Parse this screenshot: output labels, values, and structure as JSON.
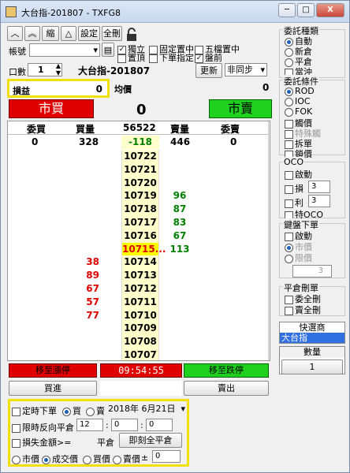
{
  "window": {
    "title": "大台指-201807 - TXFG8",
    "min": "─",
    "max": "□",
    "close": "X"
  },
  "toolbar": {
    "up1": "︿",
    "up2": "︽",
    "shrink": "縮",
    "triangle": "△",
    "settings": "設定",
    "delete_all": "全刪"
  },
  "account": {
    "label": "帳號",
    "value": ""
  },
  "opts": {
    "independent": {
      "label": "獨立",
      "checked": true
    },
    "pin": {
      "label": "置頂",
      "checked": false
    },
    "fixed_center": {
      "label": "固定置中",
      "checked": false
    },
    "below_specify": {
      "label": "下單指定",
      "checked": false
    },
    "five_center": {
      "label": "五檔置中",
      "checked": false
    },
    "ticks": {
      "label": "盤前",
      "checked": true
    }
  },
  "qty": {
    "label": "口數",
    "value": "1"
  },
  "product": {
    "name": "大台指-201807",
    "refresh": "更新",
    "sync": "非同步"
  },
  "pnl": {
    "label": "損益",
    "value": "0",
    "avg_label": "均價",
    "avg_value": "0"
  },
  "market_buy": "市買",
  "market_sell": "市賣",
  "center_position": "0",
  "grid": {
    "headers": {
      "bid_order": "委買",
      "bid_qty": "買量",
      "price": "56522",
      "ask_qty": "賣量",
      "ask_order": "委賣"
    },
    "summary": {
      "bid_order": "0",
      "bid_qty": "328",
      "change": "-118",
      "ask_qty": "446",
      "ask_order": "0"
    },
    "rows": [
      {
        "price": "10722",
        "bid": "",
        "ask": ""
      },
      {
        "price": "10721",
        "bid": "",
        "ask": ""
      },
      {
        "price": "10720",
        "bid": "",
        "ask": ""
      },
      {
        "price": "10719",
        "bid": "",
        "ask": "96"
      },
      {
        "price": "10718",
        "bid": "",
        "ask": "87"
      },
      {
        "price": "10717",
        "bid": "",
        "ask": "83"
      },
      {
        "price": "10716",
        "bid": "",
        "ask": "67"
      },
      {
        "price": "10715...",
        "bid": "",
        "ask": "113",
        "current": true
      },
      {
        "price": "10714",
        "bid": "38",
        "ask": ""
      },
      {
        "price": "10713",
        "bid": "89",
        "ask": ""
      },
      {
        "price": "10712",
        "bid": "67",
        "ask": ""
      },
      {
        "price": "10711",
        "bid": "57",
        "ask": ""
      },
      {
        "price": "10710",
        "bid": "77",
        "ask": ""
      },
      {
        "price": "10709",
        "bid": "",
        "ask": ""
      },
      {
        "price": "10708",
        "bid": "",
        "ask": ""
      },
      {
        "price": "10707",
        "bid": "",
        "ask": ""
      }
    ]
  },
  "bottom": {
    "move_stop_loss": "移至漲停",
    "time": "09:54:55",
    "move_stop_down": "移至跌停",
    "buy": "買進",
    "sell": "賣出"
  },
  "schedule": {
    "timed_order": "定時下單",
    "buy": "買",
    "sell": "賣",
    "date": "2018年 6月21日",
    "reverse_close": "限時反向平倉",
    "hh": "12",
    "mm": "0",
    "ss": "0",
    "loss_amount": "損失金額>=",
    "close_label": "平倉",
    "close_all": "即刻全平倉",
    "market": "市價",
    "deal_price": "成交價",
    "bid_price": "買價",
    "ask_price": "賣價",
    "plusminus": "±",
    "offset": "0"
  },
  "order_type": {
    "title": "委託種類",
    "items": [
      {
        "label": "自動",
        "selected": true
      },
      {
        "label": "新倉",
        "selected": false
      },
      {
        "label": "平倉",
        "selected": false
      },
      {
        "label": "當沖",
        "selected": false
      }
    ]
  },
  "order_cond": {
    "title": "委託條件",
    "items": [
      {
        "label": "ROD",
        "selected": true
      },
      {
        "label": "IOC",
        "selected": false
      },
      {
        "label": "FOK",
        "selected": false
      }
    ],
    "checks": [
      "觸價",
      "特殊觸",
      "拆單",
      "鎖價"
    ]
  },
  "oco": {
    "title": "OCO",
    "start": "啟動",
    "loss": "損",
    "loss_v": "3",
    "profit": "利",
    "profit_v": "3",
    "special": "特OCO"
  },
  "chase": {
    "title": "鍵盤下單",
    "start": "啟動",
    "market": "市價",
    "limit": "限價",
    "value": "3"
  },
  "close_pos": {
    "title": "平倉刪單",
    "del_buy": "委全刪",
    "del_sell": "賣全刪"
  },
  "quick": {
    "title": "快選商",
    "item": "大台指"
  },
  "count": {
    "title": "數量",
    "value": "1"
  },
  "colors": {
    "buy_red": "#e00000",
    "sell_green": "#008000",
    "highlight": "#f0e10a"
  }
}
